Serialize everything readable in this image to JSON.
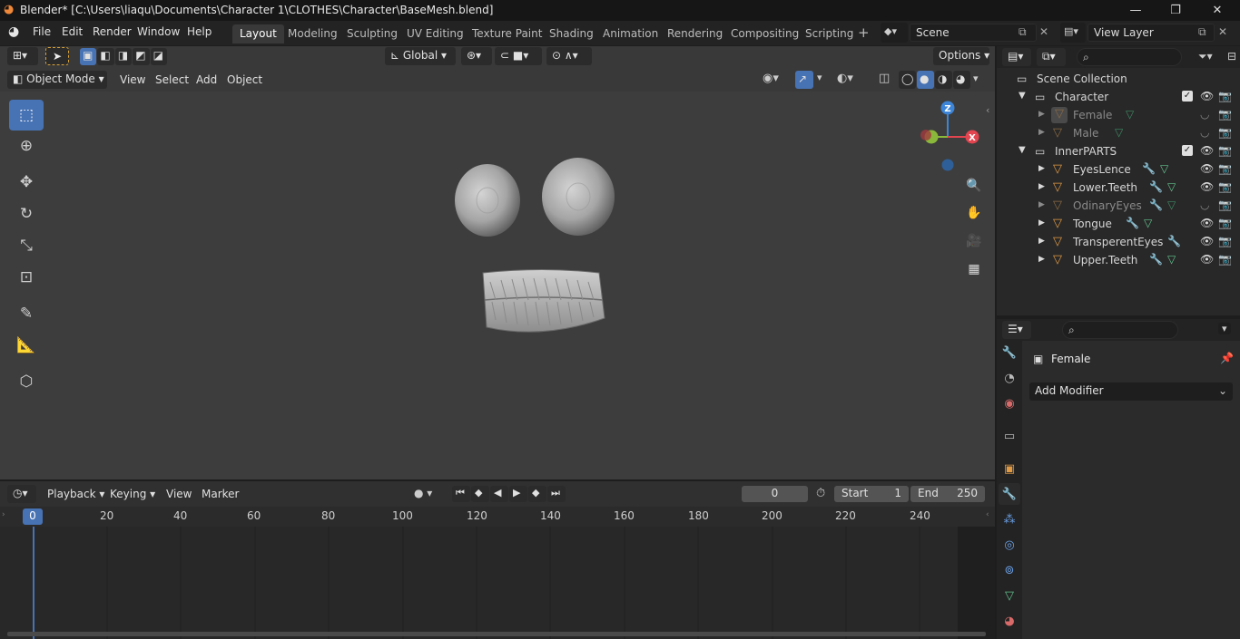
{
  "window": {
    "title": "Blender* [C:\\Users\\liaqu\\Documents\\Character 1\\CLOTHES\\Character\\BaseMesh.blend]",
    "minimize": "—",
    "maximize": "❐",
    "close": "✕"
  },
  "menu": [
    "File",
    "Edit",
    "Render",
    "Window",
    "Help"
  ],
  "workspaces": [
    "Layout",
    "Modeling",
    "Sculpting",
    "UV Editing",
    "Texture Paint",
    "Shading",
    "Animation",
    "Rendering",
    "Compositing",
    "Scripting"
  ],
  "active_workspace": "Layout",
  "add_workspace": "+",
  "scene": {
    "name": "Scene"
  },
  "view_layer": {
    "name": "View Layer"
  },
  "viewport": {
    "transform_orientation": "Global",
    "options": "Options",
    "mode": "Object Mode",
    "header_menus": [
      "View",
      "Select",
      "Add",
      "Object"
    ],
    "gizmo_axes": {
      "x": "X",
      "y": "Y",
      "z": "Z"
    }
  },
  "timeline": {
    "menus": [
      "Playback",
      "Keying",
      "View",
      "Marker"
    ],
    "current_frame": "0",
    "start_label": "Start",
    "start": "1",
    "end_label": "End",
    "end": "250",
    "ruler_marks": [
      "0",
      "20",
      "40",
      "60",
      "80",
      "100",
      "120",
      "140",
      "160",
      "180",
      "200",
      "220",
      "240"
    ],
    "playhead": "0"
  },
  "outliner": {
    "root": "Scene Collection",
    "collections": [
      {
        "name": "Character",
        "items": [
          {
            "name": "Female",
            "dimmed": true,
            "modifier": false
          },
          {
            "name": "Male",
            "dimmed": true,
            "modifier": false
          }
        ]
      },
      {
        "name": "InnerPARTS",
        "items": [
          {
            "name": "EyesLence",
            "dimmed": false,
            "modifier": true
          },
          {
            "name": "Lower.Teeth",
            "dimmed": false,
            "modifier": true
          },
          {
            "name": "OdinaryEyes",
            "dimmed": true,
            "modifier": true
          },
          {
            "name": "Tongue",
            "dimmed": false,
            "modifier": true
          },
          {
            "name": "TransperentEyes",
            "dimmed": false,
            "modifier": true
          },
          {
            "name": "Upper.Teeth",
            "dimmed": false,
            "modifier": true
          }
        ]
      }
    ]
  },
  "properties": {
    "object_name": "Female",
    "add_modifier": "Add Modifier"
  },
  "colors": {
    "accent": "#4772b3",
    "object_orange": "#e09a44",
    "mesh_green": "#62c28e",
    "axis_x": "#e2454f",
    "axis_y": "#8ab83b",
    "axis_z": "#3d85d8"
  }
}
